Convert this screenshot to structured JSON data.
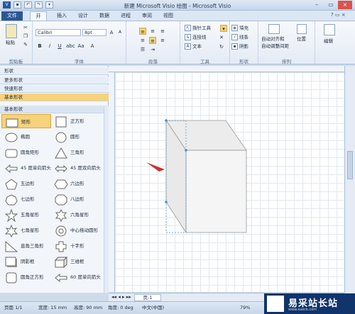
{
  "window": {
    "title": "新建 Microsoft Visio 绘图 - Microsoft Visio"
  },
  "tabs": {
    "file": "文件",
    "home": "开始",
    "insert": "插入",
    "design": "设计",
    "data": "数据",
    "process": "进程",
    "review": "审阅",
    "view": "视图"
  },
  "ribbon": {
    "clipboard": {
      "paste": "粘贴",
      "label": "剪贴板"
    },
    "font": {
      "name": "Calibri",
      "size": "8pt",
      "label": "字体"
    },
    "paragraph": {
      "label": "段落"
    },
    "tools": {
      "pointer": "指针工具",
      "connector": "连接线",
      "text": "文本",
      "label": "工具"
    },
    "shape": {
      "fill": "填充",
      "line": "线条",
      "shadow": "阴影",
      "label": "形状"
    },
    "arrange": {
      "align": "自动对齐和",
      "space": "自动调整间距",
      "position": "位置",
      "label": "排列"
    },
    "edit": {
      "label": "编辑"
    }
  },
  "pane": {
    "shapes": "形状",
    "more": "更多形状",
    "quick": "快速形状",
    "basic": "基本形状",
    "section": "基本形状",
    "items": [
      "矩形",
      "正方形",
      "椭圆",
      "圆形",
      "圆角矩形",
      "三角形",
      "45 度单向箭头",
      "45 度双向箭头",
      "五边形",
      "六边形",
      "七边形",
      "八边形",
      "五角星形",
      "六角星形",
      "七角星形",
      "中心拖动圆形",
      "直角三角形",
      "十字形",
      "阴影框",
      "三维框",
      "圆角正方形",
      "60 度单向箭头"
    ]
  },
  "pagetab": "页-1",
  "status": {
    "page": "页面 1/1",
    "width": "宽度: 15 mm",
    "height": "高度: 90 mm",
    "angle": "角度: 0 deg",
    "lang": "中文(中国)",
    "zoom": "79%"
  },
  "watermark": {
    "brand": "易采站长站",
    "url": "www.easck.com"
  }
}
